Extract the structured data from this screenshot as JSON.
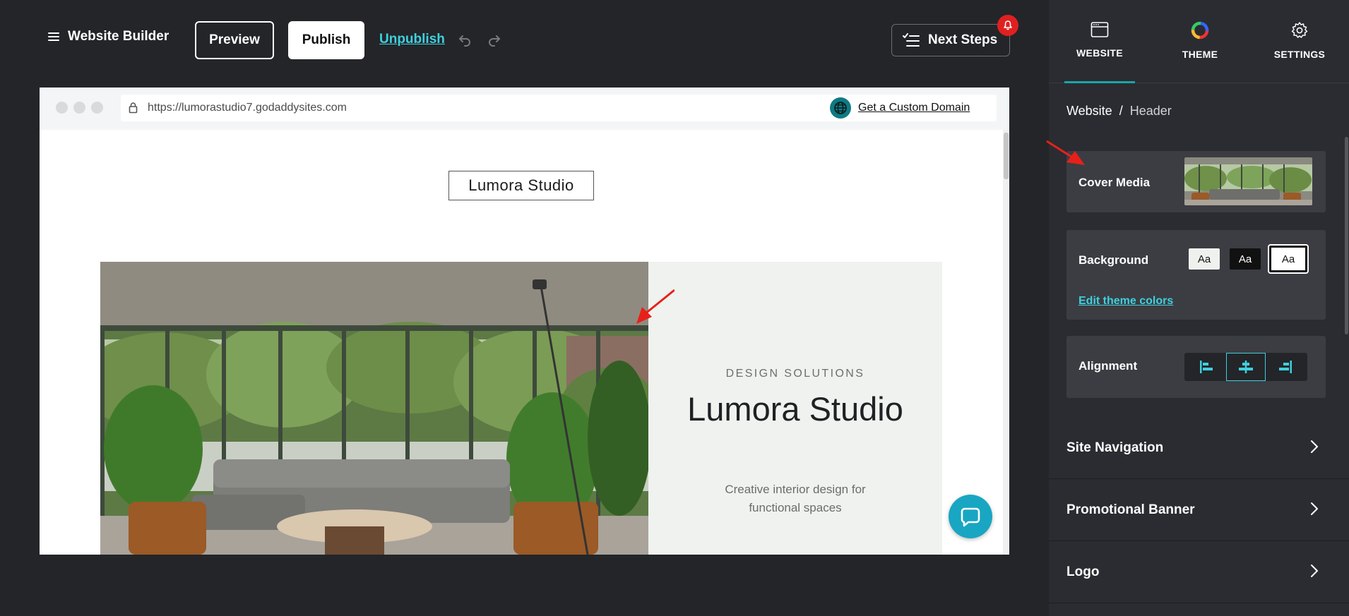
{
  "topbar": {
    "menu_label": "Website Builder",
    "preview_label": "Preview",
    "publish_label": "Publish",
    "unpublish_label": "Unpublish",
    "next_steps_label": "Next Steps"
  },
  "browser": {
    "url": "https://lumorastudio7.godaddysites.com",
    "domain_link": "Get a Custom Domain"
  },
  "site": {
    "logo_text": "Lumora Studio",
    "hero": {
      "eyebrow": "DESIGN SOLUTIONS",
      "title": "Lumora Studio",
      "subtitle": "Creative interior design for functional spaces"
    }
  },
  "panel": {
    "tabs": [
      {
        "label": "WEBSITE",
        "icon": "browser-window-icon",
        "active": true
      },
      {
        "label": "THEME",
        "icon": "color-wheel-icon",
        "active": false
      },
      {
        "label": "SETTINGS",
        "icon": "gear-icon",
        "active": false
      }
    ],
    "breadcrumb": {
      "root": "Website",
      "separator": "/",
      "current": "Header"
    },
    "cover_media": {
      "label": "Cover Media"
    },
    "background": {
      "label": "Background",
      "swatches": [
        "Aa",
        "Aa",
        "Aa"
      ],
      "selected_index": 2,
      "edit_link": "Edit theme colors"
    },
    "alignment": {
      "label": "Alignment",
      "options": [
        "left",
        "center",
        "right"
      ],
      "selected": "center"
    },
    "sections": [
      {
        "label": "Site Navigation"
      },
      {
        "label": "Promotional Banner"
      },
      {
        "label": "Logo"
      }
    ]
  },
  "colors": {
    "accent": "#3fd0de",
    "tab_underline": "#19a6a9",
    "panel_bg": "#2a2c31",
    "card_bg": "#3b3d43",
    "notification": "#e02020",
    "chat": "#19a6c3",
    "annotation_arrow": "#e8201a"
  }
}
